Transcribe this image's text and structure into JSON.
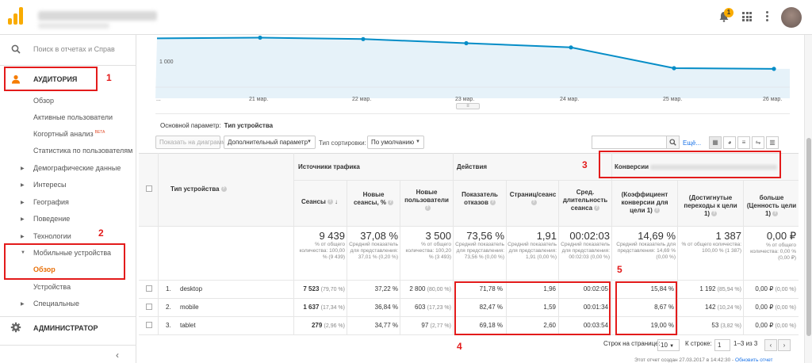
{
  "topbar": {
    "notification_count": "1"
  },
  "sidebar": {
    "search_placeholder": "Поиск в отчетах и Справ",
    "audience_label": "АУДИТОРИЯ",
    "items": [
      {
        "label": "Обзор"
      },
      {
        "label": "Активные пользователи"
      },
      {
        "label": "Когортный анализ",
        "badge": "BETA"
      },
      {
        "label": "Статистика по пользователям"
      },
      {
        "label": "Демографические данные"
      },
      {
        "label": "Интересы"
      },
      {
        "label": "География"
      },
      {
        "label": "Поведение"
      },
      {
        "label": "Технологии"
      },
      {
        "label": "Мобильные устройства"
      },
      {
        "label": "Обзор"
      },
      {
        "label": "Устройства"
      },
      {
        "label": "Специальные"
      }
    ],
    "admin_label": "АДМИНИСТРАТОР"
  },
  "chart": {
    "y_label": "1 000",
    "x_labels": [
      "...",
      "21 мар.",
      "22 мар.",
      "23 мар.",
      "24 мар.",
      "25 мар.",
      "26 мар."
    ],
    "points": [
      1175,
      1180,
      1170,
      1140,
      1110,
      960,
      955
    ],
    "line_color": "#058dc7",
    "fill_color": "#e6f2f9"
  },
  "controls": {
    "primary_dim_label": "Основной параметр:",
    "primary_dim_value": "Тип устройства",
    "show_on_chart": "Показать на диаграмме",
    "secondary_dim": "Дополнительный параметр",
    "sort_type_label": "Тип сортировки:",
    "sort_type_value": "По умолчанию",
    "more_link": "Ещё..."
  },
  "table": {
    "group_traffic": "Источники трафика",
    "group_actions": "Действия",
    "group_conversions": "Конверсии",
    "col_device": "Тип устройства",
    "col_sessions": "Сеансы",
    "col_new_sessions": "Новые сеансы, %",
    "col_new_users": "Новые пользователи",
    "col_bounce": "Показатель отказов",
    "col_pages": "Страниц/сеанс",
    "col_duration": "Сред. длительность сеанса",
    "col_conv_rate": "(Коэффициент конверсии для цели 1)",
    "col_goal_completions": "(Достигнутые переходы к цели 1)",
    "col_goal_value": "больше (Ценность цели 1)",
    "totals": {
      "sessions": "9 439",
      "sessions_sub": "% от общего количества: 100,00 % (9 439)",
      "new_sessions": "37,08 %",
      "new_sessions_sub": "Средний показатель для представления: 37,01 % (0,20 %)",
      "new_users": "3 500",
      "new_users_sub": "% от общего количества: 100,20 % (3 493)",
      "bounce": "73,56 %",
      "bounce_sub": "Средний показатель для представления: 73,56 % (0,00 %)",
      "pages": "1,91",
      "pages_sub": "Средний показатель для представления: 1,91 (0,00 %)",
      "duration": "00:02:03",
      "duration_sub": "Средний показатель для представления: 00:02:03 (0,00 %)",
      "conv_rate": "14,69 %",
      "conv_rate_sub": "Средний показатель для представления: 14,69 % (0,00 %)",
      "goal_completions": "1 387",
      "goal_completions_sub": "% от общего количества: 100,00 % (1 387)",
      "goal_value": "0,00 ₽",
      "goal_value_sub": "% от общего количества: 0,00 % (0,00 ₽)"
    },
    "rows": [
      {
        "num": "1.",
        "device": "desktop",
        "sessions": "7 523",
        "sessions_pct": "(79,70 %)",
        "new_sessions": "37,22 %",
        "new_users": "2 800",
        "new_users_pct": "(80,00 %)",
        "bounce": "71,78 %",
        "pages": "1,96",
        "duration": "00:02:05",
        "conv_rate": "15,84 %",
        "goal_completions": "1 192",
        "goal_completions_pct": "(85,94 %)",
        "goal_value": "0,00 ₽",
        "goal_value_pct": "(0,00 %)"
      },
      {
        "num": "2.",
        "device": "mobile",
        "sessions": "1 637",
        "sessions_pct": "(17,34 %)",
        "new_sessions": "36,84 %",
        "new_users": "603",
        "new_users_pct": "(17,23 %)",
        "bounce": "82,47 %",
        "pages": "1,59",
        "duration": "00:01:34",
        "conv_rate": "8,67 %",
        "goal_completions": "142",
        "goal_completions_pct": "(10,24 %)",
        "goal_value": "0,00 ₽",
        "goal_value_pct": "(0,00 %)"
      },
      {
        "num": "3.",
        "device": "tablet",
        "sessions": "279",
        "sessions_pct": "(2,96 %)",
        "new_sessions": "34,77 %",
        "new_users": "97",
        "new_users_pct": "(2,77 %)",
        "bounce": "69,18 %",
        "pages": "2,60",
        "duration": "00:03:54",
        "conv_rate": "19,00 %",
        "goal_completions": "53",
        "goal_completions_pct": "(3,82 %)",
        "goal_value": "0,00 ₽",
        "goal_value_pct": "(0,00 %)"
      }
    ]
  },
  "pagination": {
    "rows_per_page_label": "Строк на странице:",
    "rows_per_page": "10",
    "goto_label": "К строке:",
    "goto_value": "1",
    "range": "1–3 из 3"
  },
  "footnote": "Этот отчет создан 27.03.2017 в 14:42:30 -",
  "footnote_link": "Обновить отчет",
  "annotations": [
    "1",
    "2",
    "3",
    "4",
    "5"
  ],
  "annotation_color": "#e31b1b"
}
